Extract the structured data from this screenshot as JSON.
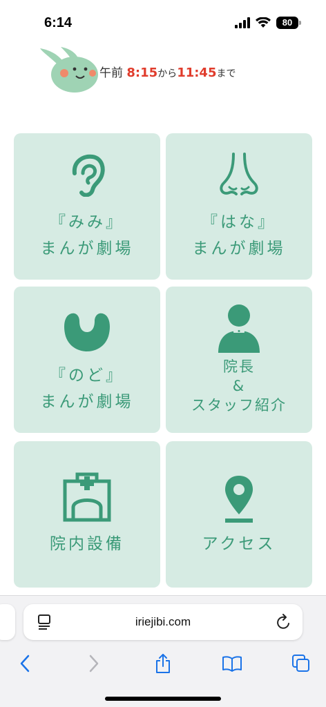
{
  "status": {
    "time": "6:14",
    "battery": "80"
  },
  "hours": {
    "prefix": "午前",
    "start": "8:15",
    "from": "から",
    "end": "11:45",
    "until": "まで"
  },
  "tiles": [
    {
      "line1": "『みみ』",
      "line2": "まんが劇場"
    },
    {
      "line1": "『はな』",
      "line2": "まんが劇場"
    },
    {
      "line1": "『のど』",
      "line2": "まんが劇場"
    },
    {
      "line1": "院長",
      "line2": "&",
      "line3": "スタッフ紹介"
    },
    {
      "line1": "院内設備"
    },
    {
      "line1": "アクセス"
    }
  ],
  "browser": {
    "url": "iriejibi.com"
  },
  "colors": {
    "accent": "#3b9a78",
    "tile_bg": "#d6ebe3",
    "time_red": "#e03c2c",
    "ios_blue": "#1a73e8"
  }
}
